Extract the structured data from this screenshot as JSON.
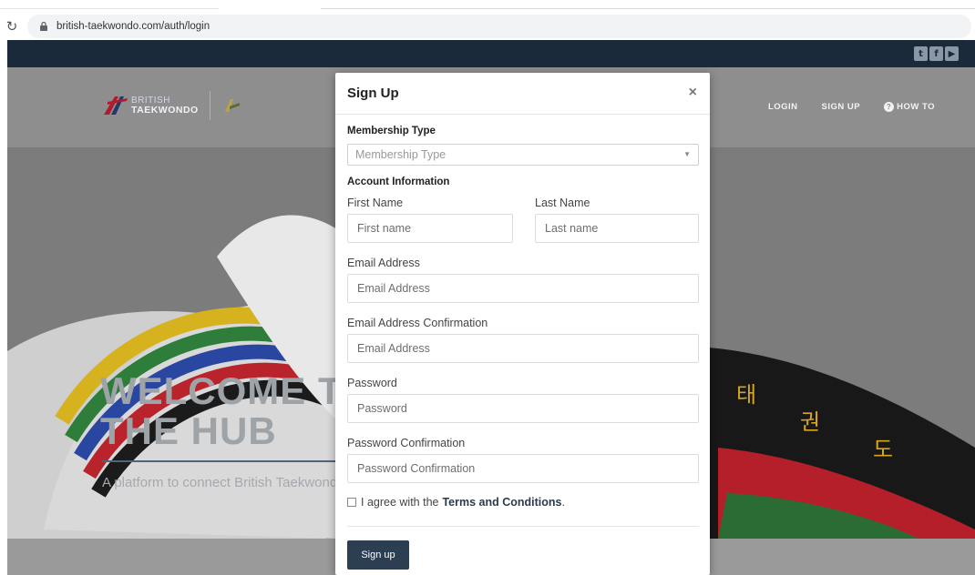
{
  "browser": {
    "url": "british-taekwondo.com/auth/login"
  },
  "header": {
    "social": {
      "icons": [
        "twitter-icon",
        "facebook-icon",
        "youtube-icon"
      ]
    },
    "logo": {
      "line1": "BRITISH",
      "line2": "TAEKWONDO"
    },
    "nav": {
      "login": "LOGIN",
      "signup": "SIGN UP",
      "howto": "HOW TO"
    }
  },
  "hero": {
    "title_line1": "WELCOME TO",
    "title_line2": "THE HUB",
    "subtitle": "A platform to connect British Taekwondo"
  },
  "modal": {
    "title": "Sign Up",
    "close_symbol": "×",
    "membership": {
      "section_label": "Membership Type",
      "placeholder": "Membership Type"
    },
    "account": {
      "section_label": "Account Information",
      "first_name_label": "First Name",
      "first_name_placeholder": "First name",
      "last_name_label": "Last Name",
      "last_name_placeholder": "Last name",
      "email_label": "Email Address",
      "email_placeholder": "Email Address",
      "email_confirm_label": "Email Address Confirmation",
      "email_confirm_placeholder": "Email Address",
      "password_label": "Password",
      "password_placeholder": "Password",
      "password_confirm_label": "Password Confirmation",
      "password_confirm_placeholder": "Password Confirmation"
    },
    "terms": {
      "prefix": "I agree with the",
      "link": "Terms and Conditions",
      "suffix": "."
    },
    "submit_label": "Sign up"
  },
  "colors": {
    "navy": "#1b2a3a",
    "button": "#2b3e52",
    "accent_red": "#c8102e"
  }
}
